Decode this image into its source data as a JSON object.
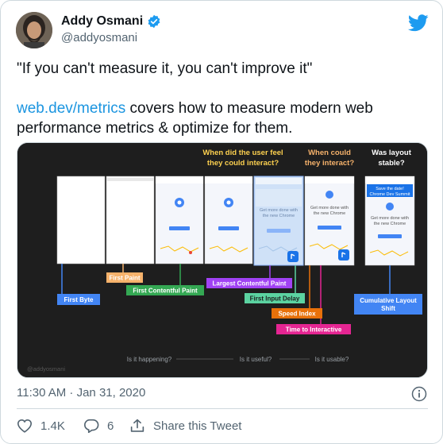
{
  "author": {
    "name": "Addy Osmani",
    "handle": "@addyosmani"
  },
  "tweet": {
    "quote": "\"If you can't measure it, you can't improve it\"",
    "link_text": "web.dev/metrics",
    "body_rest_line1": " covers how to measure modern web",
    "body_line2": "performance metrics & optimize for them."
  },
  "media": {
    "questions": {
      "feel": [
        "When did the user feel",
        "they could interact?"
      ],
      "could": [
        "When could",
        "they interact?"
      ],
      "stable": [
        "Was layout",
        "stable?"
      ]
    },
    "screen_texts": {
      "get_more": [
        "Get more done with",
        "the new Chrome"
      ],
      "save_date": [
        "Save the date!",
        "Chrome Dev Summit"
      ]
    },
    "metrics": {
      "first_byte": "First Byte",
      "first_paint": "First Paint",
      "fcp": "First Contentful Paint",
      "lcp": "Largest Contentful Paint",
      "fid": "First Input Delay",
      "si": "Speed Index",
      "tti": "Time to Interactive",
      "cls": [
        "Cumulative Layout",
        "Shift"
      ]
    },
    "bottom": {
      "q1": "Is it happening?",
      "q2": "Is it useful?",
      "q3": "Is it usable?",
      "watermark": "@addyosmani"
    },
    "colors": {
      "blue": "#4285f4",
      "orange": "#f6b26b",
      "green": "#34a853",
      "purple": "#a142f4",
      "teal": "#5bd3a1",
      "deep_orange": "#e8710a",
      "magenta": "#e52592",
      "yellow": "#fcd04f"
    }
  },
  "meta": {
    "timestamp": "11:30 AM · Jan 31, 2020"
  },
  "actions": {
    "likes": "1.4K",
    "replies": "6",
    "share": "Share this Tweet"
  }
}
